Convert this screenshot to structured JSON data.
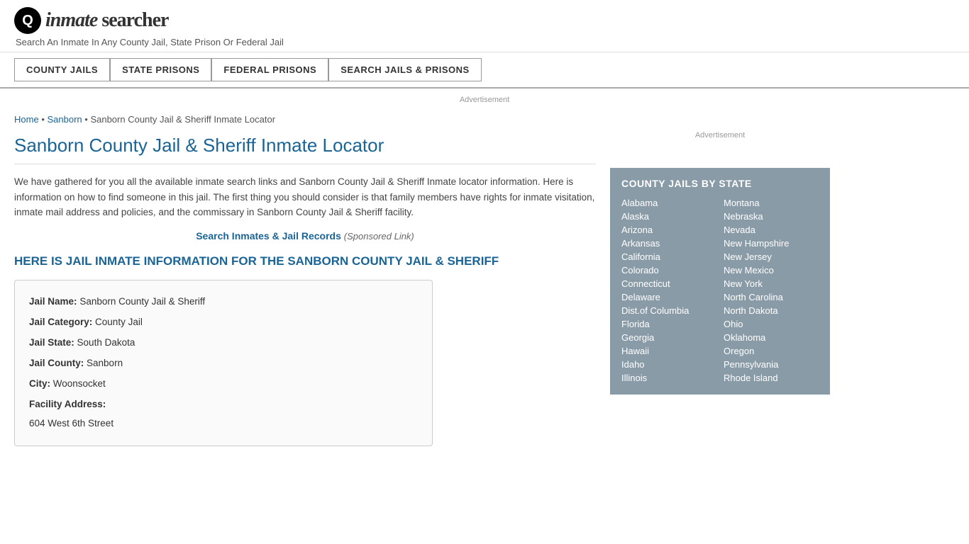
{
  "header": {
    "logo_icon": "Q",
    "logo_text_inmate": "inmate",
    "logo_text_searcher": "searcher",
    "tagline": "Search An Inmate In Any County Jail, State Prison Or Federal Jail"
  },
  "nav": {
    "buttons": [
      {
        "id": "county-jails",
        "label": "COUNTY JAILS"
      },
      {
        "id": "state-prisons",
        "label": "STATE PRISONS"
      },
      {
        "id": "federal-prisons",
        "label": "FEDERAL PRISONS"
      },
      {
        "id": "search-jails",
        "label": "SEARCH JAILS & PRISONS"
      }
    ]
  },
  "ad_top": "Advertisement",
  "breadcrumb": {
    "home": "Home",
    "sanborn": "Sanborn",
    "current": "Sanborn County Jail & Sheriff Inmate Locator"
  },
  "page_title": "Sanborn County Jail & Sheriff Inmate Locator",
  "description": "We have gathered for you all the available inmate search links and Sanborn County Jail & Sheriff Inmate locator information. Here is information on how to find someone in this jail. The first thing you should consider is that family members have rights for inmate visitation, inmate mail address and policies, and the commissary in Sanborn County Jail & Sheriff facility.",
  "sponsored": {
    "link_text": "Search Inmates & Jail Records",
    "label": "(Sponsored Link)"
  },
  "section_header": "HERE IS JAIL INMATE INFORMATION FOR THE SANBORN COUNTY JAIL & SHERIFF",
  "info_box": {
    "jail_name_label": "Jail Name:",
    "jail_name_value": "Sanborn County Jail & Sheriff",
    "jail_category_label": "Jail Category:",
    "jail_category_value": "County Jail",
    "jail_state_label": "Jail State:",
    "jail_state_value": "South Dakota",
    "jail_county_label": "Jail County:",
    "jail_county_value": "Sanborn",
    "city_label": "City:",
    "city_value": "Woonsocket",
    "facility_address_label": "Facility Address:",
    "facility_address_value": "604 West 6th Street"
  },
  "sidebar": {
    "ad_label": "Advertisement",
    "county_jails_title": "COUNTY JAILS BY STATE",
    "states_col1": [
      "Alabama",
      "Alaska",
      "Arizona",
      "Arkansas",
      "California",
      "Colorado",
      "Connecticut",
      "Delaware",
      "Dist.of Columbia",
      "Florida",
      "Georgia",
      "Hawaii",
      "Idaho",
      "Illinois"
    ],
    "states_col2": [
      "Montana",
      "Nebraska",
      "Nevada",
      "New Hampshire",
      "New Jersey",
      "New Mexico",
      "New York",
      "North Carolina",
      "North Dakota",
      "Ohio",
      "Oklahoma",
      "Oregon",
      "Pennsylvania",
      "Rhode Island"
    ]
  }
}
